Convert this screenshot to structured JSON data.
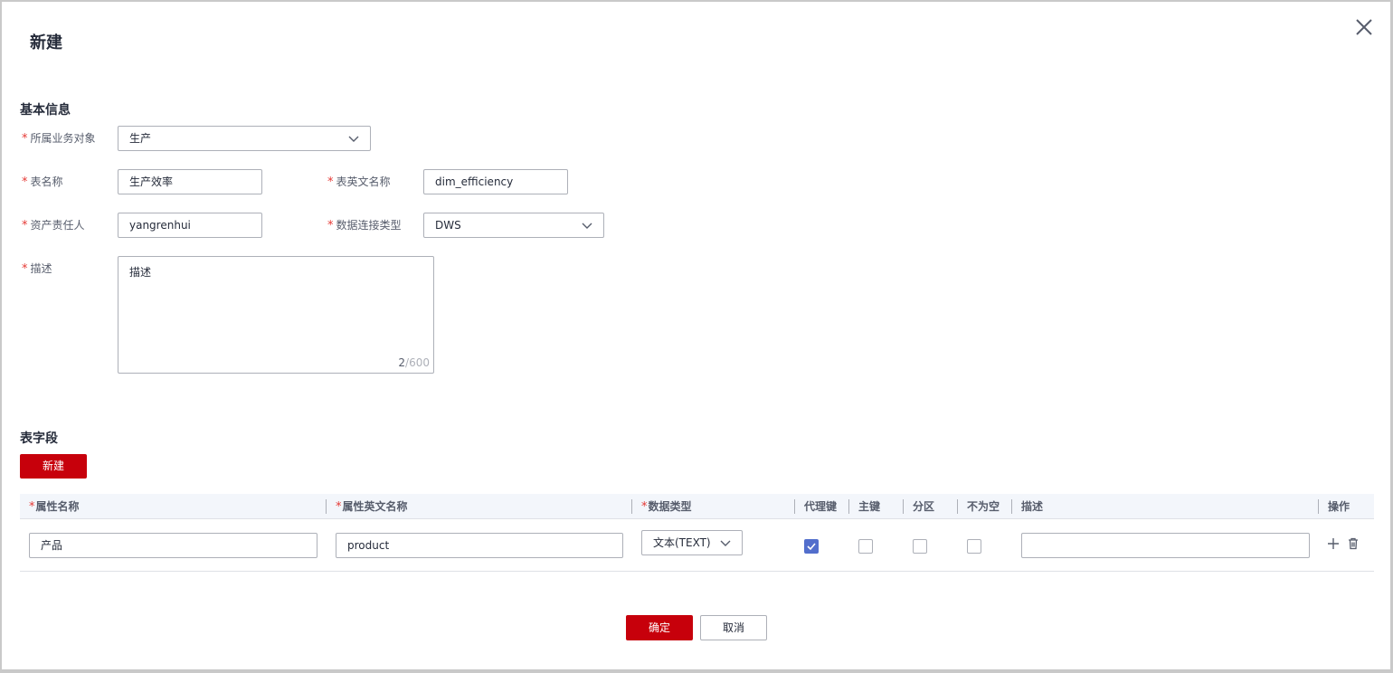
{
  "dialog": {
    "title": "新建",
    "close_icon": "close-icon"
  },
  "basic": {
    "section_title": "基本信息",
    "business_object": {
      "label": "所属业务对象",
      "value": "生产"
    },
    "table_name": {
      "label": "表名称",
      "value": "生产效率"
    },
    "table_en_name": {
      "label": "表英文名称",
      "value": "dim_efficiency"
    },
    "owner": {
      "label": "资产责任人",
      "value": "yangrenhui"
    },
    "conn_type": {
      "label": "数据连接类型",
      "value": "DWS"
    },
    "description": {
      "label": "描述",
      "value": "描述",
      "count": "2",
      "max": "/600"
    }
  },
  "fields": {
    "section_title": "表字段",
    "new_button": "新建",
    "columns": {
      "attr_name": "属性名称",
      "attr_en_name": "属性英文名称",
      "data_type": "数据类型",
      "surrogate_key": "代理键",
      "primary_key": "主键",
      "partition": "分区",
      "not_null": "不为空",
      "description": "描述",
      "operation": "操作"
    },
    "rows": [
      {
        "attr_name": "产品",
        "attr_en_name": "product",
        "data_type": "文本(TEXT)",
        "surrogate_key": true,
        "primary_key": false,
        "partition": false,
        "not_null": false,
        "description": ""
      }
    ],
    "icons": {
      "add": "plus-icon",
      "delete": "trash-icon"
    }
  },
  "footer": {
    "confirm": "确定",
    "cancel": "取消"
  },
  "colors": {
    "primary": "#c7000b",
    "checkbox_checked": "#526ecc",
    "required": "#e53935"
  }
}
